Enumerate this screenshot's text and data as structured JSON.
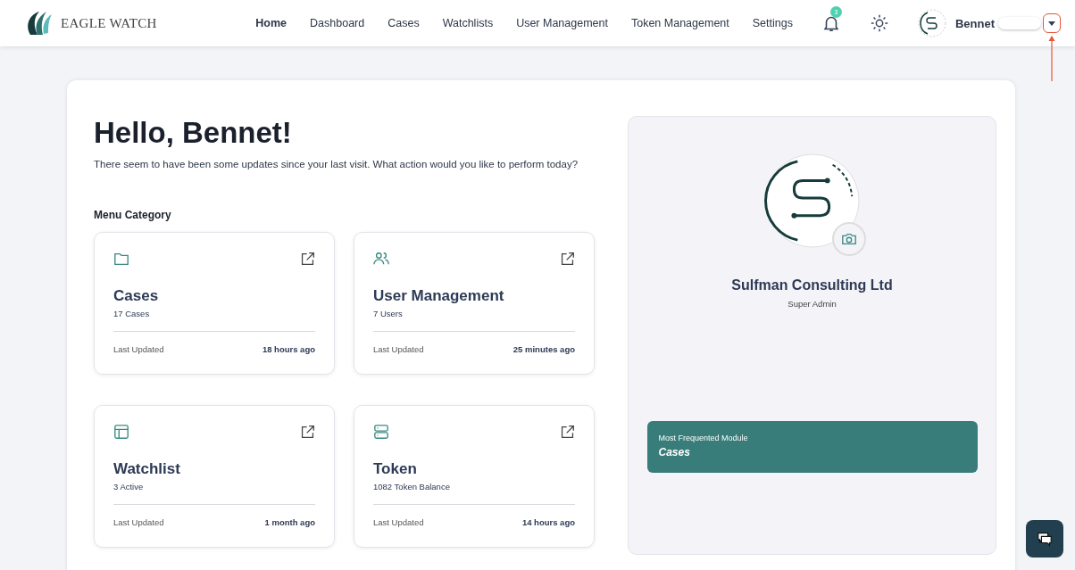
{
  "brand": {
    "name": "EAGLE WATCH"
  },
  "nav": [
    {
      "label": "Home",
      "selected": true
    },
    {
      "label": "Dashboard",
      "selected": false
    },
    {
      "label": "Cases",
      "selected": false
    },
    {
      "label": "Watchlists",
      "selected": false
    },
    {
      "label": "User Management",
      "selected": false
    },
    {
      "label": "Token Management",
      "selected": false
    },
    {
      "label": "Settings",
      "selected": false
    }
  ],
  "notifications": {
    "count": "3"
  },
  "user": {
    "name": "Bennet"
  },
  "greeting": {
    "title": "Hello, Bennet!",
    "subtitle": "There seem to have been some updates since your last visit. What action would you like to perform today?"
  },
  "menu_category": {
    "heading": "Menu Category",
    "cards": [
      {
        "kind": "folder",
        "title": "Cases",
        "count": "17 Cases",
        "updated_label": "Last Updated",
        "updated": "18 hours ago"
      },
      {
        "kind": "users",
        "title": "User Management",
        "count": "7 Users",
        "updated_label": "Last Updated",
        "updated": "25 minutes ago"
      },
      {
        "kind": "layout",
        "title": "Watchlist",
        "count": "3 Active",
        "updated_label": "Last Updated",
        "updated": "1 month ago"
      },
      {
        "kind": "server",
        "title": "Token",
        "count": "1082 Token Balance",
        "updated_label": "Last Updated",
        "updated": "14 hours ago"
      }
    ]
  },
  "profile": {
    "organization": "Sulfman Consulting Ltd",
    "role": "Super Admin",
    "most_frequented": {
      "label": "Most Frequented Module",
      "value": "Cases"
    }
  }
}
